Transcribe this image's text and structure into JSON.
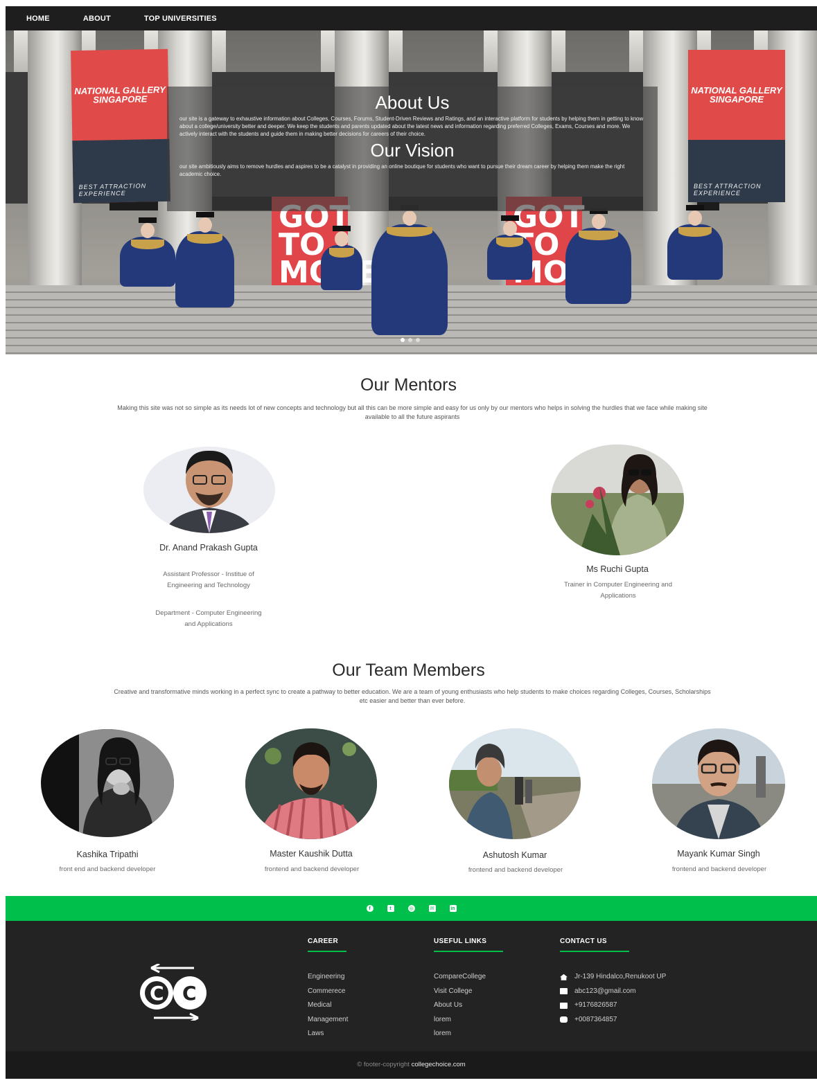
{
  "nav": {
    "items": [
      "HOME",
      "ABOUT",
      "TOP UNIVERSITIES"
    ]
  },
  "hero": {
    "banner_left_title": "NATIONAL GALLERY SINGAPORE",
    "banner_left_bottom": "BEST ATTRACTION EXPERIENCE",
    "banner_right_title": "NATIONAL GALLERY SINGAPORE",
    "banner_right_bottom": "BEST ATTRACTION EXPERIENCE",
    "panel_text": "GOT TO MOVE",
    "about_title": "About Us",
    "about_text": "our site is a gateway to exhaustive information about Colleges, Courses, Forums, Student-Driven Reviews and Ratings, and an interactive platform for students by helping them in getting to know about a college/university better and deeper. We keep the students and parents updated about the latest news and information regarding preferred Colleges, Exams, Courses and more. We actively interact with the students and guide them in making better decisions for careers of their choice.",
    "vision_title": "Our Vision",
    "vision_text": "our site ambitiously aims to remove hurdles and aspires to be a catalyst in providing an online boutique for students who want to pursue their dream career by helping them make the right academic choice."
  },
  "mentors": {
    "title": "Our Mentors",
    "description": "Making this site was not so simple as its needs lot of new concepts and technology but all this can be more simple and easy for us only by our mentors who helps in solving the hurdles that we face while making site available to all the future aspirants",
    "people": [
      {
        "name": "Dr. Anand Prakash Gupta",
        "role1": "Assistant Professor - Institue of Engineering and Technology",
        "role2": "Department - Computer Engineering and Applications"
      },
      {
        "name": "Ms Ruchi Gupta",
        "role1": "Trainer in Computer Engineering and Applications"
      }
    ]
  },
  "team": {
    "title": "Our Team Members",
    "description": "Creative and transformative minds working in a perfect sync to create a pathway to better education. We are a team of young enthusiasts who help students to make choices regarding Colleges, Courses, Scholarships etc easier and better than ever before.",
    "members": [
      {
        "name": "Kashika Tripathi",
        "role": "front end and backend developer"
      },
      {
        "name": "Master Kaushik Dutta",
        "role": "frontend and backend developer"
      },
      {
        "name": "Ashutosh Kumar",
        "role": "frontend and backend developer"
      },
      {
        "name": "Mayank Kumar Singh",
        "role": "frontend and backend developer"
      }
    ]
  },
  "social": {
    "icons": [
      "facebook-icon",
      "twitter-icon",
      "instagram-icon",
      "mail-icon",
      "linkedin-icon"
    ],
    "accent": "#00c04b"
  },
  "footer": {
    "career": {
      "title": "CAREER",
      "items": [
        "Engineering",
        "Commerece",
        "Medical",
        "Management",
        "Laws"
      ]
    },
    "links": {
      "title": "USEFUL LINKS",
      "items": [
        "CompareCollege",
        "Visit College",
        "About Us",
        "lorem",
        "lorem"
      ]
    },
    "contact": {
      "title": "CONTACT US",
      "items": [
        "Jr-139 Hindalco,Renukoot UP",
        "abc123@gmail.com",
        "+9176826587",
        "+0087364857"
      ]
    },
    "copyright_prefix": "© footer-copyright",
    "copyright_site": "collegechoice.com"
  }
}
